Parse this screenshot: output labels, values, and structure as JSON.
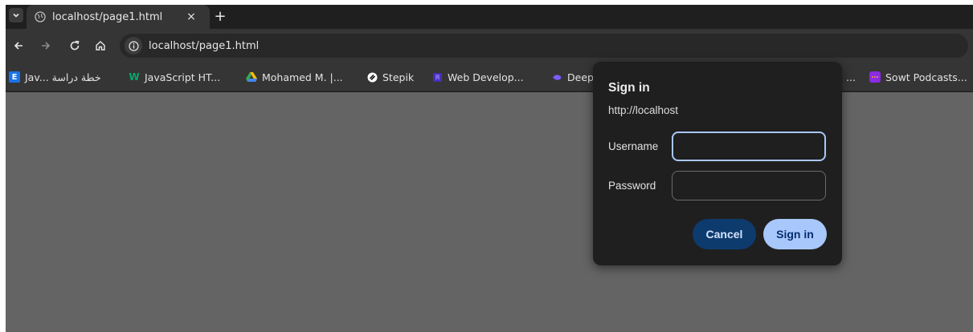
{
  "tab": {
    "title": "localhost/page1.html",
    "close_label": "×",
    "new_tab_label": "+"
  },
  "toolbar": {
    "url": "localhost/page1.html"
  },
  "bookmarks": [
    {
      "label": "Jav... خطة دراسة",
      "icon": "E",
      "icon_color": "#1a73e8"
    },
    {
      "label": "JavaScript HT...",
      "icon": "W",
      "icon_color": "#04aa6d"
    },
    {
      "label": "Mohamed M. |...",
      "icon": "google-drive-icon",
      "icon_color": "#fbbc04"
    },
    {
      "label": "Stepik",
      "icon": "stepik-icon",
      "icon_color": "#ffffff"
    },
    {
      "label": "Web Develop...",
      "icon": "bookmark-icon",
      "icon_color": "#5b3fd1"
    },
    {
      "label": "Deep",
      "icon": "deepseek-icon",
      "icon_color": "#7c5cff"
    },
    {
      "label": "...",
      "icon": "",
      "icon_color": ""
    },
    {
      "label": "Sowt Podcasts...",
      "icon": "sowt-icon",
      "icon_color": "#8b2be2"
    }
  ],
  "dialog": {
    "title": "Sign in",
    "origin": "http://localhost",
    "username_label": "Username",
    "username_value": "",
    "password_label": "Password",
    "password_value": "",
    "cancel_label": "Cancel",
    "signin_label": "Sign in"
  },
  "colors": {
    "content_background": "#646464",
    "dialog_background": "#1f1f1f",
    "primary_button": "#a8c7fa",
    "secondary_button": "#0d3b6e",
    "focus_ring": "#a8c7fa"
  }
}
